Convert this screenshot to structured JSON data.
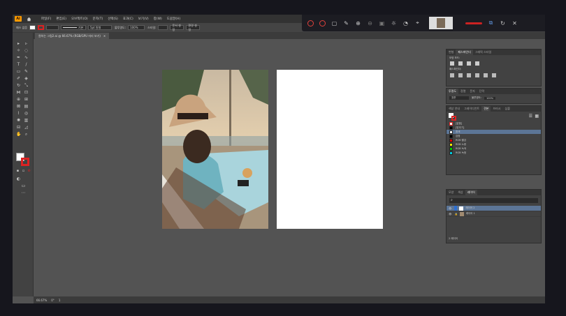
{
  "menubar": {
    "logo": "Ai",
    "items": [
      "파일(F)",
      "편집(E)",
      "오브젝트(O)",
      "문자(T)",
      "선택(S)",
      "효과(C)",
      "보기(V)",
      "창(W)",
      "도움말(H)"
    ]
  },
  "ctrlbar": {
    "mode_label": "패스 없음",
    "stroke_label": "기본",
    "brush_label": "5pt 원형",
    "opacity_label": "불투명도:",
    "opacity_value": "100%",
    "style_label": "스타일:",
    "doc_setup_button": "문서 설정",
    "prefs_button": "환경 설정"
  },
  "document": {
    "tab_title": "원하는 그림2.ai @ 66.67% (RGB/GPU 미리 보기)"
  },
  "panels": {
    "top_tabs": [
      "변형",
      "패스파인더",
      "그래픽 스타일"
    ],
    "shape_mode_label": "모양 모드:",
    "pathfinder_label": "패스파인더:",
    "properties_tabs": [
      "투명도",
      "정렬",
      "문자",
      "단락"
    ],
    "blend_mode": "표준",
    "opacity_label": "불투명도:",
    "opacity_value": "100%",
    "swatch_tabs": [
      "색상 안내",
      "그레이디언트",
      "견본",
      "브러시",
      "심볼"
    ],
    "swatches": [
      {
        "name": "[없음]",
        "color": "#ffffff"
      },
      {
        "name": "[맞추기]",
        "color": "#000000"
      },
      {
        "name": "흰색",
        "color": "#ffffff"
      },
      {
        "name": "검정",
        "color": "#000000"
      },
      {
        "name": "RGB 빨강",
        "color": "#e00000"
      },
      {
        "name": "RGB 노랑",
        "color": "#ffee00"
      },
      {
        "name": "RGB 녹색",
        "color": "#00cc00"
      },
      {
        "name": "RGB 녹청",
        "color": "#00ccdd"
      }
    ],
    "selected_swatch": 2,
    "layer_tabs": [
      "모양",
      "색상",
      "레이어"
    ],
    "layers": [
      "레이어 2",
      "레이어 1"
    ],
    "layers_count": "2 레이어"
  },
  "statusbar": {
    "zoom": "66.67%",
    "angle": "0°",
    "page": "1"
  },
  "colors": {
    "accent": "#ff9a00",
    "stroke_red": "#dd2222",
    "selection": "#5c7596"
  }
}
